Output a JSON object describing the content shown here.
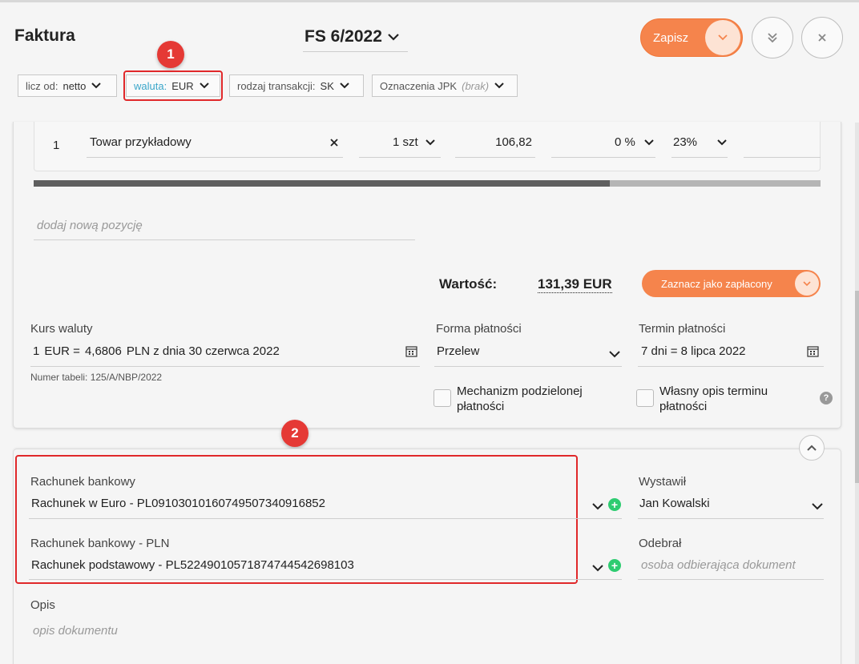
{
  "header": {
    "title": "Faktura",
    "document_number": "FS 6/2022",
    "save_label": "Zapisz"
  },
  "chips": [
    {
      "key": "licz od:",
      "value": "netto"
    },
    {
      "key": "waluta:",
      "value": "EUR"
    },
    {
      "key": "rodzaj transakcji:",
      "value": "SK"
    },
    {
      "key": "Oznaczenia JPK",
      "value": "(brak)"
    }
  ],
  "annotations": {
    "badge1": "1",
    "badge2": "2"
  },
  "item": {
    "index": "1",
    "name": "Towar przykładowy",
    "quantity": "1 szt",
    "price": "106,82",
    "discount": "0 %",
    "vat": "23%"
  },
  "add_item_placeholder": "dodaj nową pozycję",
  "total": {
    "label": "Wartość:",
    "value": "131,39 EUR",
    "paid_button": "Zaznacz jako zapłacony"
  },
  "exchange": {
    "label": "Kurs waluty",
    "amount": "1",
    "currency": "EUR =",
    "rate": "4,6806",
    "description": "PLN z dnia 30 czerwca 2022",
    "table_no": "Numer tabeli: 125/A/NBP/2022"
  },
  "payment": {
    "label": "Forma płatności",
    "value": "Przelew",
    "split_line1": "Mechanizm podzielonej",
    "split_line2": "płatności"
  },
  "due": {
    "label": "Termin płatności",
    "value": "7 dni = 8 lipca 2022",
    "custom_line1": "Własny opis terminu",
    "custom_line2": "płatności",
    "help": "?"
  },
  "bank": {
    "label": "Rachunek bankowy",
    "value": "Rachunek w Euro - PL09103010160749507340916852",
    "pln_label": "Rachunek bankowy - PLN",
    "pln_value": "Rachunek podstawowy - PL52249010571874744542698103"
  },
  "issued": {
    "label": "Wystawił",
    "value": "Jan Kowalski"
  },
  "received": {
    "label": "Odebrał",
    "placeholder": "osoba odbierająca dokument"
  },
  "description": {
    "label": "Opis",
    "placeholder": "opis dokumentu"
  },
  "colors": {
    "accent": "#f5844c",
    "annotation": "#e53935",
    "link": "#3aa6c9",
    "success": "#2ecc71"
  }
}
